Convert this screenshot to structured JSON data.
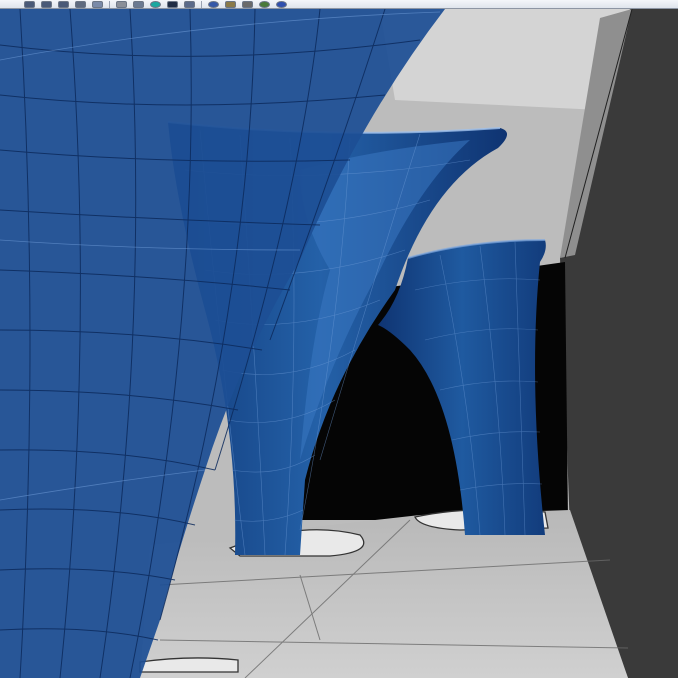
{
  "toolbar": {
    "icons": [
      {
        "name": "pointer-icon",
        "color": "#4a5a78"
      },
      {
        "name": "curve-tool-icon",
        "color": "#4a5a78"
      },
      {
        "name": "polyline-icon",
        "color": "#4a5a78"
      },
      {
        "name": "rectangle-icon",
        "color": "#5f6b80"
      },
      {
        "name": "surface-icon",
        "color": "#7a8aa8"
      },
      {
        "name": "solid-icon",
        "color": "#8a8f99"
      },
      {
        "name": "transform-icon",
        "color": "#6b7a92"
      },
      {
        "name": "sphere-render-icon",
        "color": "#1aa8a0"
      },
      {
        "name": "shaded-icon",
        "color": "#1f2c44"
      },
      {
        "name": "material-icon",
        "color": "#5a6a8a"
      },
      {
        "name": "environment-icon",
        "color": "#3558a8"
      },
      {
        "name": "layer-icon",
        "color": "#8a7a4a"
      },
      {
        "name": "properties-icon",
        "color": "#6a6a6a"
      },
      {
        "name": "render-sphere-icon",
        "color": "#4a7a3a"
      },
      {
        "name": "help-icon",
        "color": "#2f4fae"
      }
    ]
  },
  "viewport": {
    "display_mode": "shaded",
    "colors": {
      "surface_blue": "#1d4f94",
      "surface_blue_dark": "#0f3472",
      "ceiling": "#b7b7b7",
      "wall_dark": "#3a3a3a",
      "floor": "#c9c9c9",
      "opening": "#050505"
    }
  }
}
